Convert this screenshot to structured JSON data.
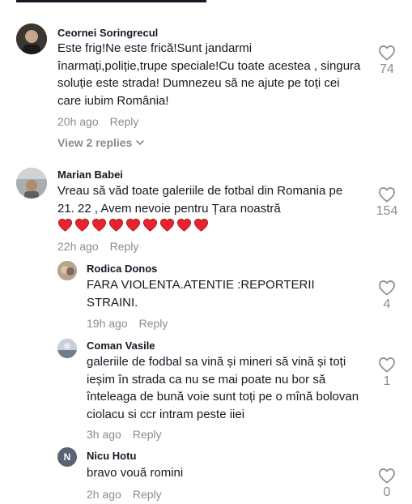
{
  "comments": [
    {
      "username": "Ceornei Soringrecul",
      "text": "Este frig!Ne este frică!Sunt jandarmi înarmați,poliție,trupe speciale!Cu toate acestea , singura soluție este strada! Dumnezeu să ne ajute pe toți cei care iubim România!",
      "time": "20h ago",
      "reply_label": "Reply",
      "likes": "74",
      "view_replies": "View 2 replies"
    },
    {
      "username": "Marian Babei",
      "text": "Vreau să văd toate galeriile de fotbal din Romania pe 21. 22 , Avem nevoie pentru Țara noastră",
      "time": "22h ago",
      "reply_label": "Reply",
      "likes": "154",
      "heart_emoji_count": 9
    }
  ],
  "replies": [
    {
      "username": "Rodica Donos",
      "text": "FARA VIOLENTA.ATENTIE :REPORTERII STRAINI.",
      "time": "19h ago",
      "reply_label": "Reply",
      "likes": "4"
    },
    {
      "username": "Coman Vasile",
      "text": "galeriile de fodbal sa vină și mineri să vină și toți ieșim în strada ca nu se mai poate nu bor să înteleaga de bună voie sunt toți pe o mînă bolovan ciolacu si ccr intram peste iiei",
      "time": "3h ago",
      "reply_label": "Reply",
      "likes": "1"
    },
    {
      "username": "Nicu Hotu",
      "text": "bravo vouă romini",
      "time": "2h ago",
      "reply_label": "Reply",
      "likes": "0",
      "avatar_initial": "N"
    }
  ],
  "colors": {
    "text": "#161823",
    "muted": "#8a8b91",
    "heart_emoji": "#e8232f",
    "avatar_initial_bg": "#5a6473"
  }
}
